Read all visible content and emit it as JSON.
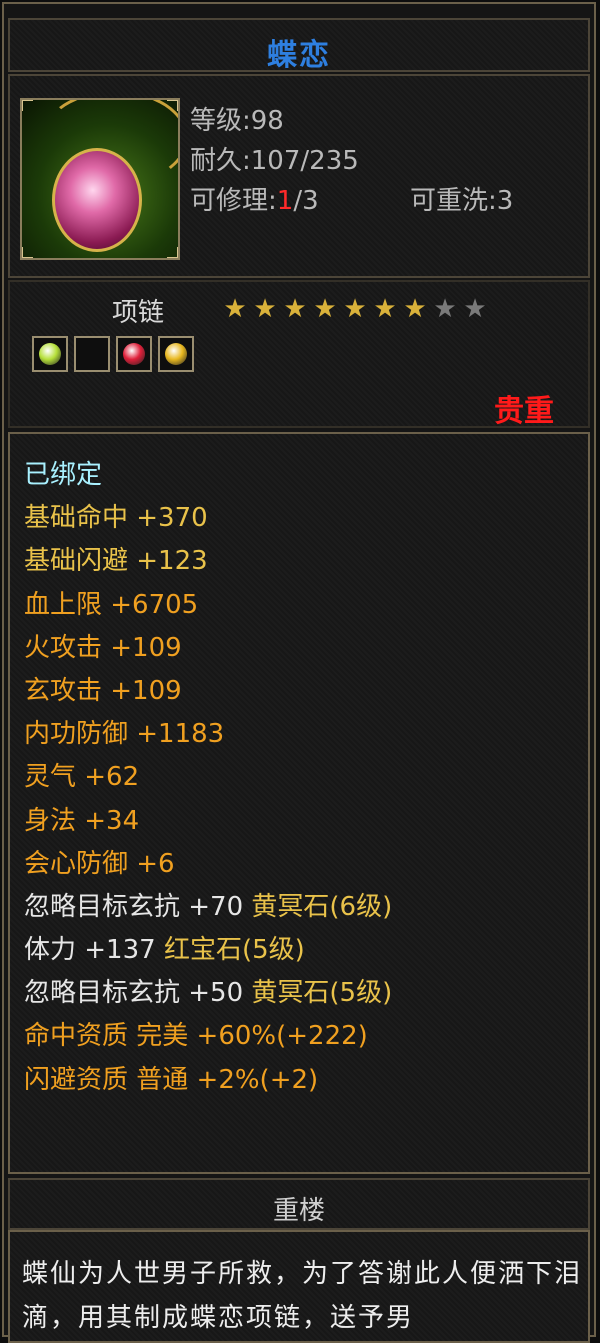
{
  "item": {
    "name": "蝶恋",
    "level_text": "等级:98",
    "durability_text": "耐久:107/235",
    "repair_label": "可修理:",
    "repair_current": "1",
    "repair_total": "/3",
    "rewash_text": "可重洗:3",
    "type": "项链",
    "stars_total": 9,
    "stars_filled": 7,
    "rarity": "贵重",
    "slots": [
      {
        "name": "yellow-green-gem",
        "color": "#b6e03a"
      },
      {
        "name": "empty",
        "color": ""
      },
      {
        "name": "red-gem",
        "color": "#e0203a"
      },
      {
        "name": "gold-gem",
        "color": "#e8b820"
      }
    ]
  },
  "attributes": [
    {
      "parts": [
        {
          "text": "已绑定",
          "cls": "bound"
        }
      ]
    },
    {
      "parts": [
        {
          "text": "基础命中 +370",
          "cls": "y"
        }
      ]
    },
    {
      "parts": [
        {
          "text": "基础闪避 +123",
          "cls": "y"
        }
      ]
    },
    {
      "parts": [
        {
          "text": "血上限 +6705",
          "cls": "o"
        }
      ]
    },
    {
      "parts": [
        {
          "text": "火攻击 +109",
          "cls": "o"
        }
      ]
    },
    {
      "parts": [
        {
          "text": "玄攻击 +109",
          "cls": "o"
        }
      ]
    },
    {
      "parts": [
        {
          "text": "内功防御 +1183",
          "cls": "o"
        }
      ]
    },
    {
      "parts": [
        {
          "text": "灵气 +62",
          "cls": "o"
        }
      ]
    },
    {
      "parts": [
        {
          "text": "身法 +34",
          "cls": "o"
        }
      ]
    },
    {
      "parts": [
        {
          "text": "会心防御 +6",
          "cls": "o"
        }
      ]
    },
    {
      "parts": [
        {
          "text": "忽略目标玄抗 +70",
          "cls": "w"
        },
        {
          "text": " 黄冥石(6级)",
          "cls": "y"
        }
      ]
    },
    {
      "parts": [
        {
          "text": "体力 +137",
          "cls": "w"
        },
        {
          "text": " 红宝石(5级)",
          "cls": "y"
        }
      ]
    },
    {
      "parts": [
        {
          "text": "忽略目标玄抗 +50",
          "cls": "w"
        },
        {
          "text": " 黄冥石(5级)",
          "cls": "y"
        }
      ]
    },
    {
      "parts": [
        {
          "text": "命中资质 完美 +60%(+222)",
          "cls": "o"
        }
      ]
    },
    {
      "parts": [
        {
          "text": "闪避资质 普通 +2%(+2)",
          "cls": "o"
        }
      ]
    }
  ],
  "section": {
    "title": "重楼",
    "description": "蝶仙为人世男子所救，为了答谢此人便洒下泪滴，用其制成蝶恋项链，送予男"
  }
}
